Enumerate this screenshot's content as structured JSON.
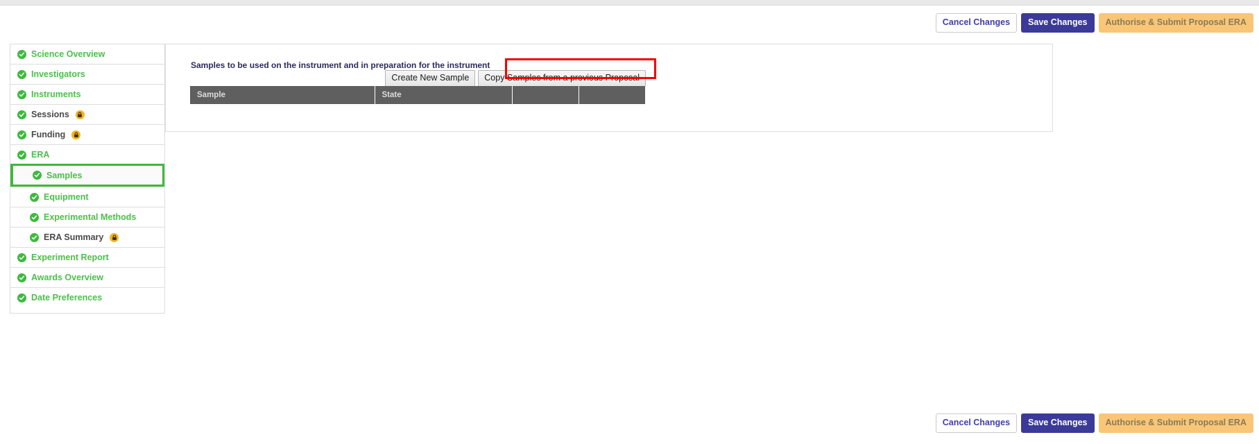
{
  "action_bar": {
    "cancel_label": "Cancel Changes",
    "save_label": "Save Changes",
    "authorise_label": "Authorise & Submit Proposal ERA",
    "colors": {
      "cancel_text": "#3f3dad",
      "save_bg": "#3b3a98",
      "authorise_bg": "#f9c678"
    }
  },
  "sidebar": {
    "items": [
      {
        "label": "Science Overview",
        "status_icon": "check-circle-icon",
        "locked": false,
        "sub": false,
        "selected": false
      },
      {
        "label": "Investigators",
        "status_icon": "check-circle-icon",
        "locked": false,
        "sub": false,
        "selected": false
      },
      {
        "label": "Instruments",
        "status_icon": "check-circle-icon",
        "locked": false,
        "sub": false,
        "selected": false
      },
      {
        "label": "Sessions",
        "status_icon": "check-circle-icon",
        "locked": true,
        "sub": false,
        "selected": false
      },
      {
        "label": "Funding",
        "status_icon": "check-circle-icon",
        "locked": true,
        "sub": false,
        "selected": false
      },
      {
        "label": "ERA",
        "status_icon": "check-circle-icon",
        "locked": false,
        "sub": false,
        "selected": false
      },
      {
        "label": "Samples",
        "status_icon": "check-circle-icon",
        "locked": false,
        "sub": true,
        "selected": true
      },
      {
        "label": "Equipment",
        "status_icon": "check-circle-icon",
        "locked": false,
        "sub": true,
        "selected": false
      },
      {
        "label": "Experimental Methods",
        "status_icon": "check-circle-icon",
        "locked": false,
        "sub": true,
        "selected": false
      },
      {
        "label": "ERA Summary",
        "status_icon": "check-circle-icon",
        "locked": true,
        "sub": true,
        "selected": false
      },
      {
        "label": "Experiment Report",
        "status_icon": "check-circle-icon",
        "locked": false,
        "sub": false,
        "selected": false
      },
      {
        "label": "Awards Overview",
        "status_icon": "check-circle-icon",
        "locked": false,
        "sub": false,
        "selected": false
      },
      {
        "label": "Date Preferences",
        "status_icon": "check-circle-icon",
        "locked": false,
        "sub": false,
        "selected": false
      }
    ],
    "colors": {
      "label_green": "#4ac04a",
      "check_green": "#3db93d",
      "lock_orange": "#f0b323",
      "selected_border": "#3db93d"
    }
  },
  "main": {
    "heading": "Samples to be used on the instrument and in preparation for the instrument",
    "buttons": {
      "create_new_sample": "Create New Sample",
      "copy_samples": "Copy Samples from a previous Proposal"
    },
    "highlight_color": "#f40000",
    "table": {
      "columns": [
        "Sample",
        "State",
        "",
        ""
      ],
      "rows": []
    }
  }
}
